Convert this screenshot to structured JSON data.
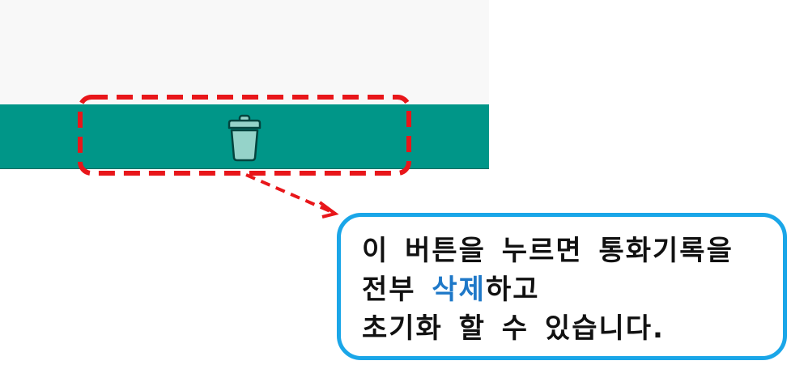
{
  "app": {
    "bottom_bar_color": "#009688",
    "delete_button_icon": "trash-icon",
    "icon_color": "#95d3c9"
  },
  "annotation": {
    "highlight_color": "#e8161a",
    "callout_border_color": "#1aa6e8",
    "callout": {
      "line1": "이 버튼을 누르면 통화기록을",
      "line2_prefix": "전부 ",
      "line2_highlight": "삭제",
      "line2_suffix": "하고",
      "line3": "초기화 할 수 있습니다."
    }
  }
}
